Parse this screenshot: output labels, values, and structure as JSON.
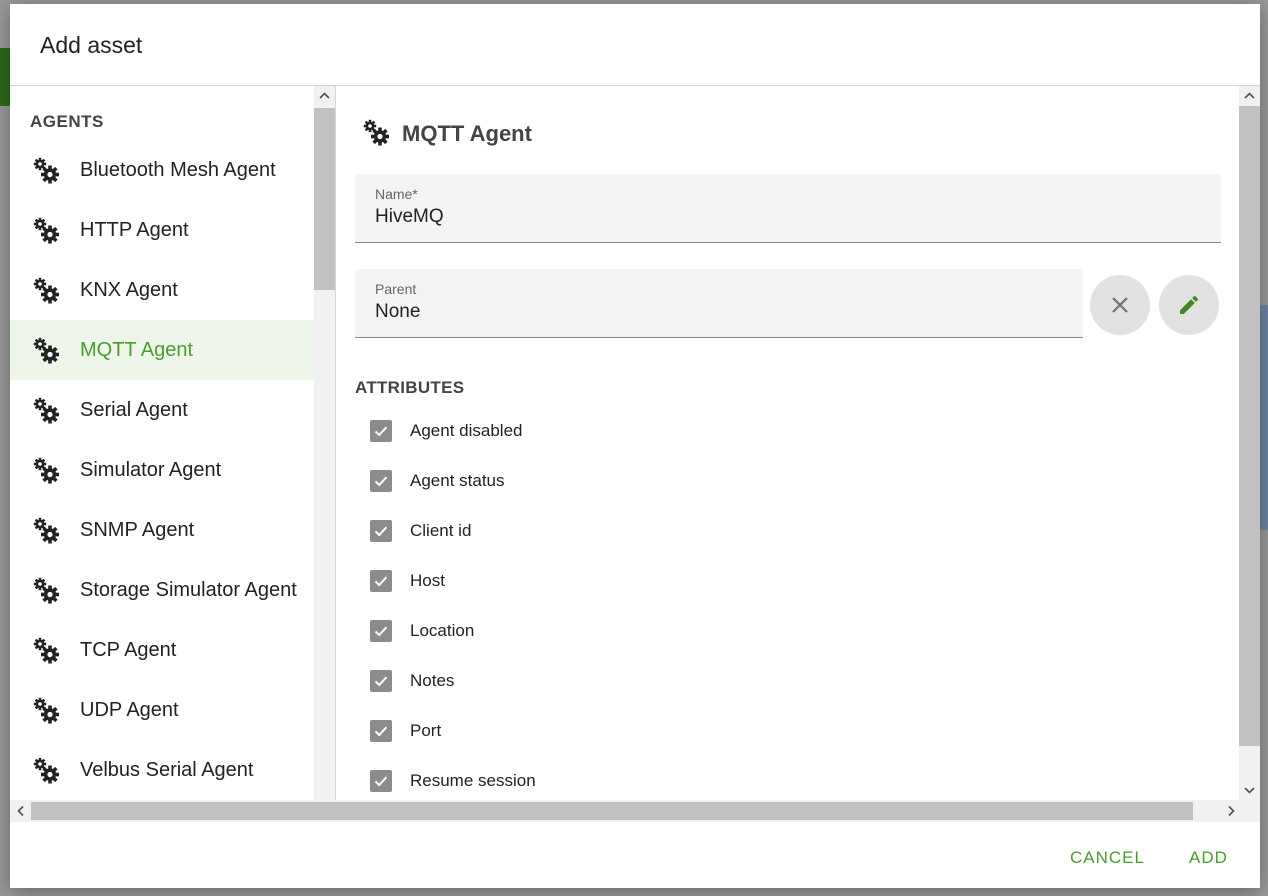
{
  "dialog": {
    "title": "Add asset"
  },
  "agents": {
    "heading": "AGENTS",
    "items": [
      {
        "label": "Bluetooth Mesh Agent",
        "selected": false
      },
      {
        "label": "HTTP Agent",
        "selected": false
      },
      {
        "label": "KNX Agent",
        "selected": false
      },
      {
        "label": "MQTT Agent",
        "selected": true
      },
      {
        "label": "Serial Agent",
        "selected": false
      },
      {
        "label": "Simulator Agent",
        "selected": false
      },
      {
        "label": "SNMP Agent",
        "selected": false
      },
      {
        "label": "Storage Simulator Agent",
        "selected": false
      },
      {
        "label": "TCP Agent",
        "selected": false
      },
      {
        "label": "UDP Agent",
        "selected": false
      },
      {
        "label": "Velbus Serial Agent",
        "selected": false
      }
    ],
    "icon": "gears-icon"
  },
  "detail": {
    "title": "MQTT Agent",
    "icon": "gears-icon",
    "name_field": {
      "label": "Name*",
      "value": "HiveMQ"
    },
    "parent_field": {
      "label": "Parent",
      "value": "None"
    },
    "clear_icon": "close-icon",
    "edit_icon": "pencil-icon",
    "attributes_heading": "ATTRIBUTES",
    "attributes": [
      {
        "label": "Agent disabled",
        "checked": true
      },
      {
        "label": "Agent status",
        "checked": true
      },
      {
        "label": "Client id",
        "checked": true
      },
      {
        "label": "Host",
        "checked": true
      },
      {
        "label": "Location",
        "checked": true
      },
      {
        "label": "Notes",
        "checked": true
      },
      {
        "label": "Port",
        "checked": true
      },
      {
        "label": "Resume session",
        "checked": true
      }
    ]
  },
  "footer": {
    "cancel_label": "CANCEL",
    "add_label": "ADD"
  },
  "colors": {
    "accent": "#4a9d2c",
    "selected_bg": "#eef5e9",
    "checkbox": "#8c8c8c"
  }
}
